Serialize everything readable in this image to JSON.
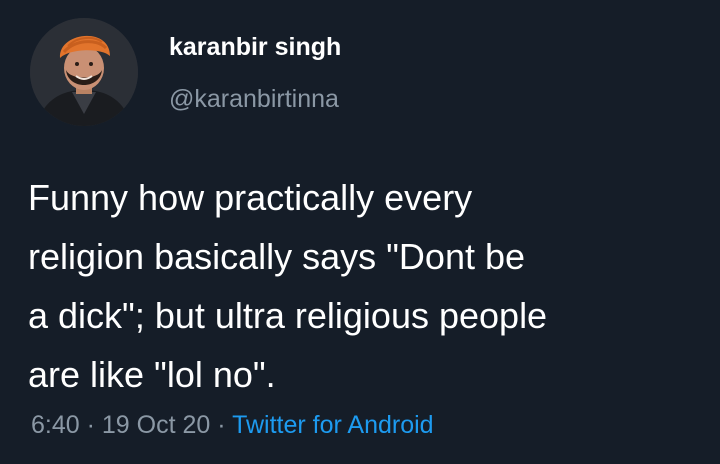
{
  "author": {
    "display_name": "karanbir singh",
    "handle": "@karanbirtinna"
  },
  "tweet": {
    "text_lines": [
      "Funny how practically every",
      "religion basically says \"Dont be",
      "a dick\"; but ultra religious people",
      "are like \"lol no\"."
    ],
    "time": "6:40",
    "separator": "·",
    "date": "19 Oct 20",
    "source": "Twitter for Android"
  },
  "colors": {
    "background": "#151d28",
    "text": "#ffffff",
    "muted": "#8b98a5",
    "link": "#1d9bf0",
    "turban": "#e2742c"
  }
}
